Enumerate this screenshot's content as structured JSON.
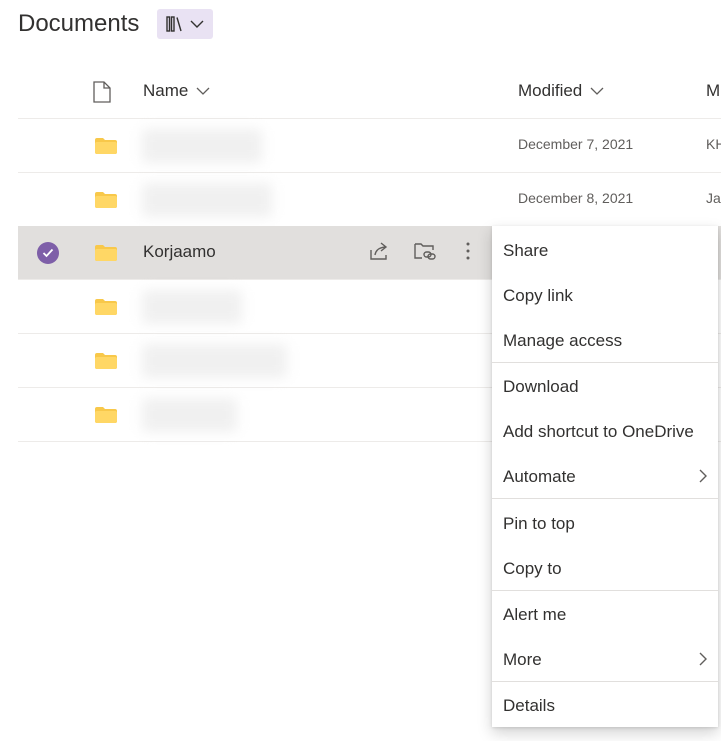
{
  "header": {
    "title": "Documents",
    "library_icon": "library-icon"
  },
  "columns": {
    "name": "Name",
    "modified": "Modified",
    "modified_by_partial": "M"
  },
  "rows": [
    {
      "name": "",
      "modified": "December 7, 2021",
      "modified_by": "KH"
    },
    {
      "name": "",
      "modified": "December 8, 2021",
      "modified_by": "Jar"
    },
    {
      "name": "Korjaamo",
      "modified": "",
      "modified_by": "",
      "selected": true
    },
    {
      "name": "",
      "modified": "",
      "modified_by": ""
    },
    {
      "name": "",
      "modified": "",
      "modified_by": ""
    },
    {
      "name": "",
      "modified": "",
      "modified_by": ""
    }
  ],
  "context_menu": {
    "items": [
      {
        "label": "Share"
      },
      {
        "label": "Copy link"
      },
      {
        "label": "Manage access"
      },
      {
        "label": "Download"
      },
      {
        "label": "Add shortcut to OneDrive"
      },
      {
        "label": "Automate",
        "submenu": true
      },
      {
        "label": "Pin to top"
      },
      {
        "label": "Copy to"
      },
      {
        "label": "Alert me"
      },
      {
        "label": "More",
        "submenu": true
      },
      {
        "label": "Details"
      }
    ]
  },
  "colors": {
    "accent": "#7e5fa8",
    "folder": "#f8c84a",
    "selected_row": "#e1dfdd"
  }
}
